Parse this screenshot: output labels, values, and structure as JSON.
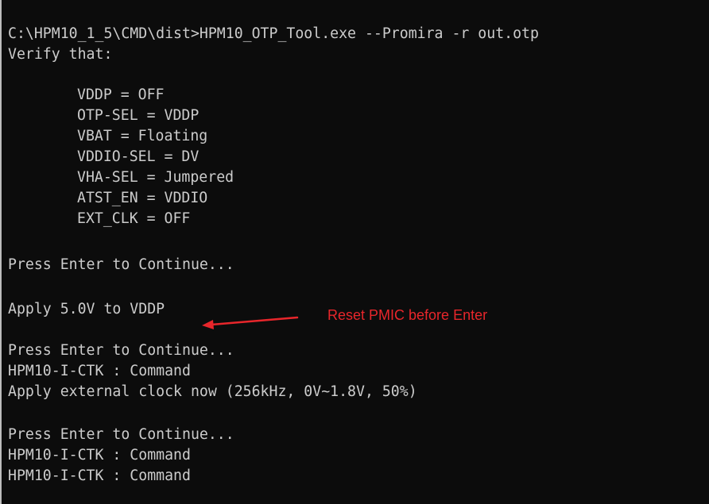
{
  "console": {
    "command_line": "C:\\HPM10_1_5\\CMD\\dist>HPM10_OTP_Tool.exe --Promira -r out.otp",
    "verify_heading": "Verify that:",
    "settings": [
      "VDDP = OFF",
      "OTP-SEL = VDDP",
      "VBAT = Floating",
      "VDDIO-SEL = DV",
      "VHA-SEL = Jumpered",
      "ATST_EN = VDDIO",
      "EXT_CLK = OFF"
    ],
    "prompt_1": "Press Enter to Continue...",
    "apply_voltage": "Apply 5.0V to VDDP",
    "prompt_2": "Press Enter to Continue...",
    "status_1": "HPM10-I-CTK : Command",
    "apply_clock": "Apply external clock now (256kHz, 0V~1.8V, 50%)",
    "prompt_3": "Press Enter to Continue...",
    "status_2": "HPM10-I-CTK : Command",
    "status_3": "HPM10-I-CTK : Command"
  },
  "annotation": {
    "text": "Reset PMIC before Enter",
    "color": "#e8262b",
    "arrow_icon": "arrow-left-icon"
  },
  "colors": {
    "background": "#0c0c0c",
    "text": "#cccccc"
  }
}
